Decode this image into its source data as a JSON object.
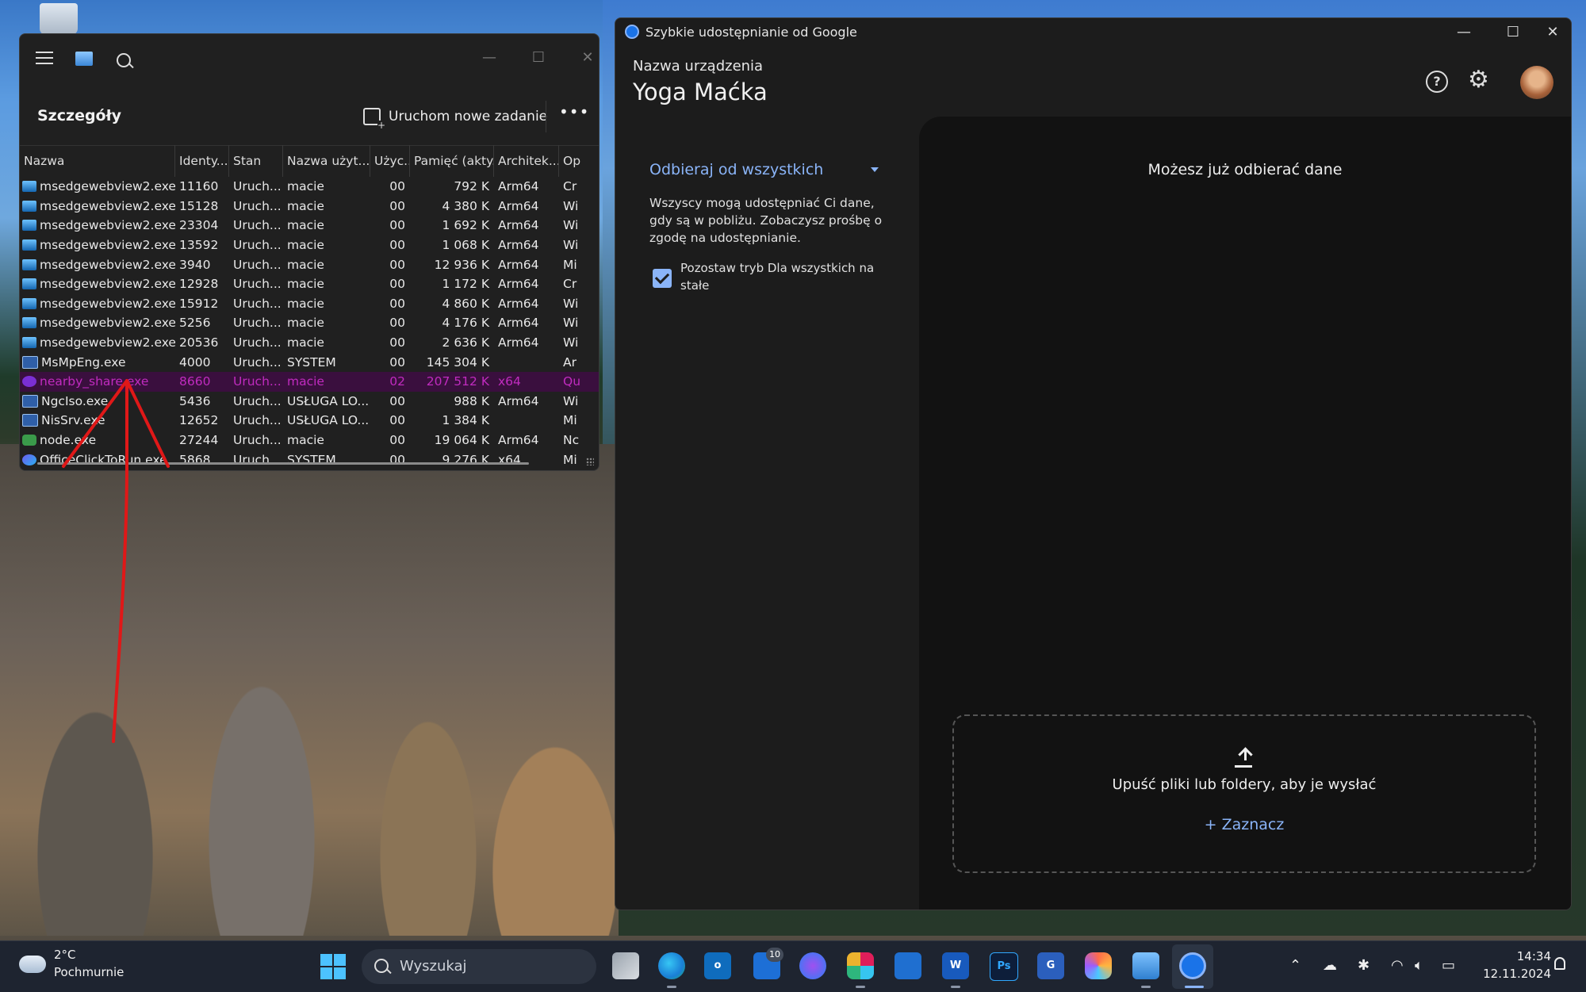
{
  "task_manager": {
    "section_title": "Szczegóły",
    "new_task_label": "Uruchom nowe zadanie",
    "more_label": "•••",
    "columns": [
      "Nazwa",
      "Identy...",
      "Stan",
      "Nazwa użyt...",
      "Użyc...",
      "Pamięć (akty...",
      "Architek...",
      "Op"
    ],
    "rows": [
      {
        "name": "msedgewebview2.exe",
        "id": "11160",
        "state": "Uruch...",
        "user": "macie",
        "cpu": "00",
        "mem": "792 K",
        "arch": "Arm64",
        "op": "Cr",
        "icon": "edge-webview-icon"
      },
      {
        "name": "msedgewebview2.exe",
        "id": "15128",
        "state": "Uruch...",
        "user": "macie",
        "cpu": "00",
        "mem": "4 380 K",
        "arch": "Arm64",
        "op": "Wi",
        "icon": "edge-webview-icon"
      },
      {
        "name": "msedgewebview2.exe",
        "id": "23304",
        "state": "Uruch...",
        "user": "macie",
        "cpu": "00",
        "mem": "1 692 K",
        "arch": "Arm64",
        "op": "Wi",
        "icon": "edge-webview-icon"
      },
      {
        "name": "msedgewebview2.exe",
        "id": "13592",
        "state": "Uruch...",
        "user": "macie",
        "cpu": "00",
        "mem": "1 068 K",
        "arch": "Arm64",
        "op": "Wi",
        "icon": "edge-webview-icon"
      },
      {
        "name": "msedgewebview2.exe",
        "id": "3940",
        "state": "Uruch...",
        "user": "macie",
        "cpu": "00",
        "mem": "12 936 K",
        "arch": "Arm64",
        "op": "Mi",
        "icon": "edge-webview-icon"
      },
      {
        "name": "msedgewebview2.exe",
        "id": "12928",
        "state": "Uruch...",
        "user": "macie",
        "cpu": "00",
        "mem": "1 172 K",
        "arch": "Arm64",
        "op": "Cr",
        "icon": "edge-webview-icon"
      },
      {
        "name": "msedgewebview2.exe",
        "id": "15912",
        "state": "Uruch...",
        "user": "macie",
        "cpu": "00",
        "mem": "4 860 K",
        "arch": "Arm64",
        "op": "Wi",
        "icon": "edge-webview-icon"
      },
      {
        "name": "msedgewebview2.exe",
        "id": "5256",
        "state": "Uruch...",
        "user": "macie",
        "cpu": "00",
        "mem": "4 176 K",
        "arch": "Arm64",
        "op": "Wi",
        "icon": "edge-webview-icon"
      },
      {
        "name": "msedgewebview2.exe",
        "id": "20536",
        "state": "Uruch...",
        "user": "macie",
        "cpu": "00",
        "mem": "2 636 K",
        "arch": "Arm64",
        "op": "Wi",
        "icon": "edge-webview-icon"
      },
      {
        "name": "MsMpEng.exe",
        "id": "4000",
        "state": "Uruch...",
        "user": "SYSTEM",
        "cpu": "00",
        "mem": "145 304 K",
        "arch": "",
        "op": "Ar",
        "icon": "window-app-icon"
      },
      {
        "name": "nearby_share.exe",
        "id": "8660",
        "state": "Uruch...",
        "user": "macie",
        "cpu": "02",
        "mem": "207 512 K",
        "arch": "x64",
        "op": "Qu",
        "icon": "nearby-share-icon",
        "highlight": true
      },
      {
        "name": "NgcIso.exe",
        "id": "5436",
        "state": "Uruch...",
        "user": "USŁUGA LO...",
        "cpu": "00",
        "mem": "988 K",
        "arch": "Arm64",
        "op": "Wi",
        "icon": "window-app-icon"
      },
      {
        "name": "NisSrv.exe",
        "id": "12652",
        "state": "Uruch...",
        "user": "USŁUGA LO...",
        "cpu": "00",
        "mem": "1 384 K",
        "arch": "",
        "op": "Mi",
        "icon": "window-app-icon"
      },
      {
        "name": "node.exe",
        "id": "27244",
        "state": "Uruch...",
        "user": "macie",
        "cpu": "00",
        "mem": "19 064 K",
        "arch": "Arm64",
        "op": "Nc",
        "icon": "node-icon"
      },
      {
        "name": "OfficeClickToRun.exe",
        "id": "5868",
        "state": "Uruch...",
        "user": "SYSTEM",
        "cpu": "00",
        "mem": "9 276 K",
        "arch": "x64",
        "op": "Mi",
        "icon": "office-icon"
      }
    ]
  },
  "quick_share": {
    "window_title": "Szybkie udostępnianie od Google",
    "device_label": "Nazwa urządzenia",
    "device_name": "Yoga Maćka",
    "mode_label": "Odbieraj od wszystkich",
    "description": "Wszyscy mogą udostępniać Ci dane, gdy są w pobliżu. Zobaczysz prośbę o zgodę na udostępnianie.",
    "checkbox_label": "Pozostaw tryb Dla wszystkich na stałe",
    "checkbox_checked": true,
    "ready_text": "Możesz już odbierać dane",
    "drop_text": "Upuść pliki lub foldery, aby je wysłać",
    "select_label": "+  Zaznacz",
    "accent_color": "#8ab4f8"
  },
  "taskbar": {
    "weather_temp": "2°C",
    "weather_desc": "Pochmurnie",
    "search_placeholder": "Wyszukaj",
    "badge_count": "10",
    "time": "14:34",
    "date": "12.11.2024"
  }
}
